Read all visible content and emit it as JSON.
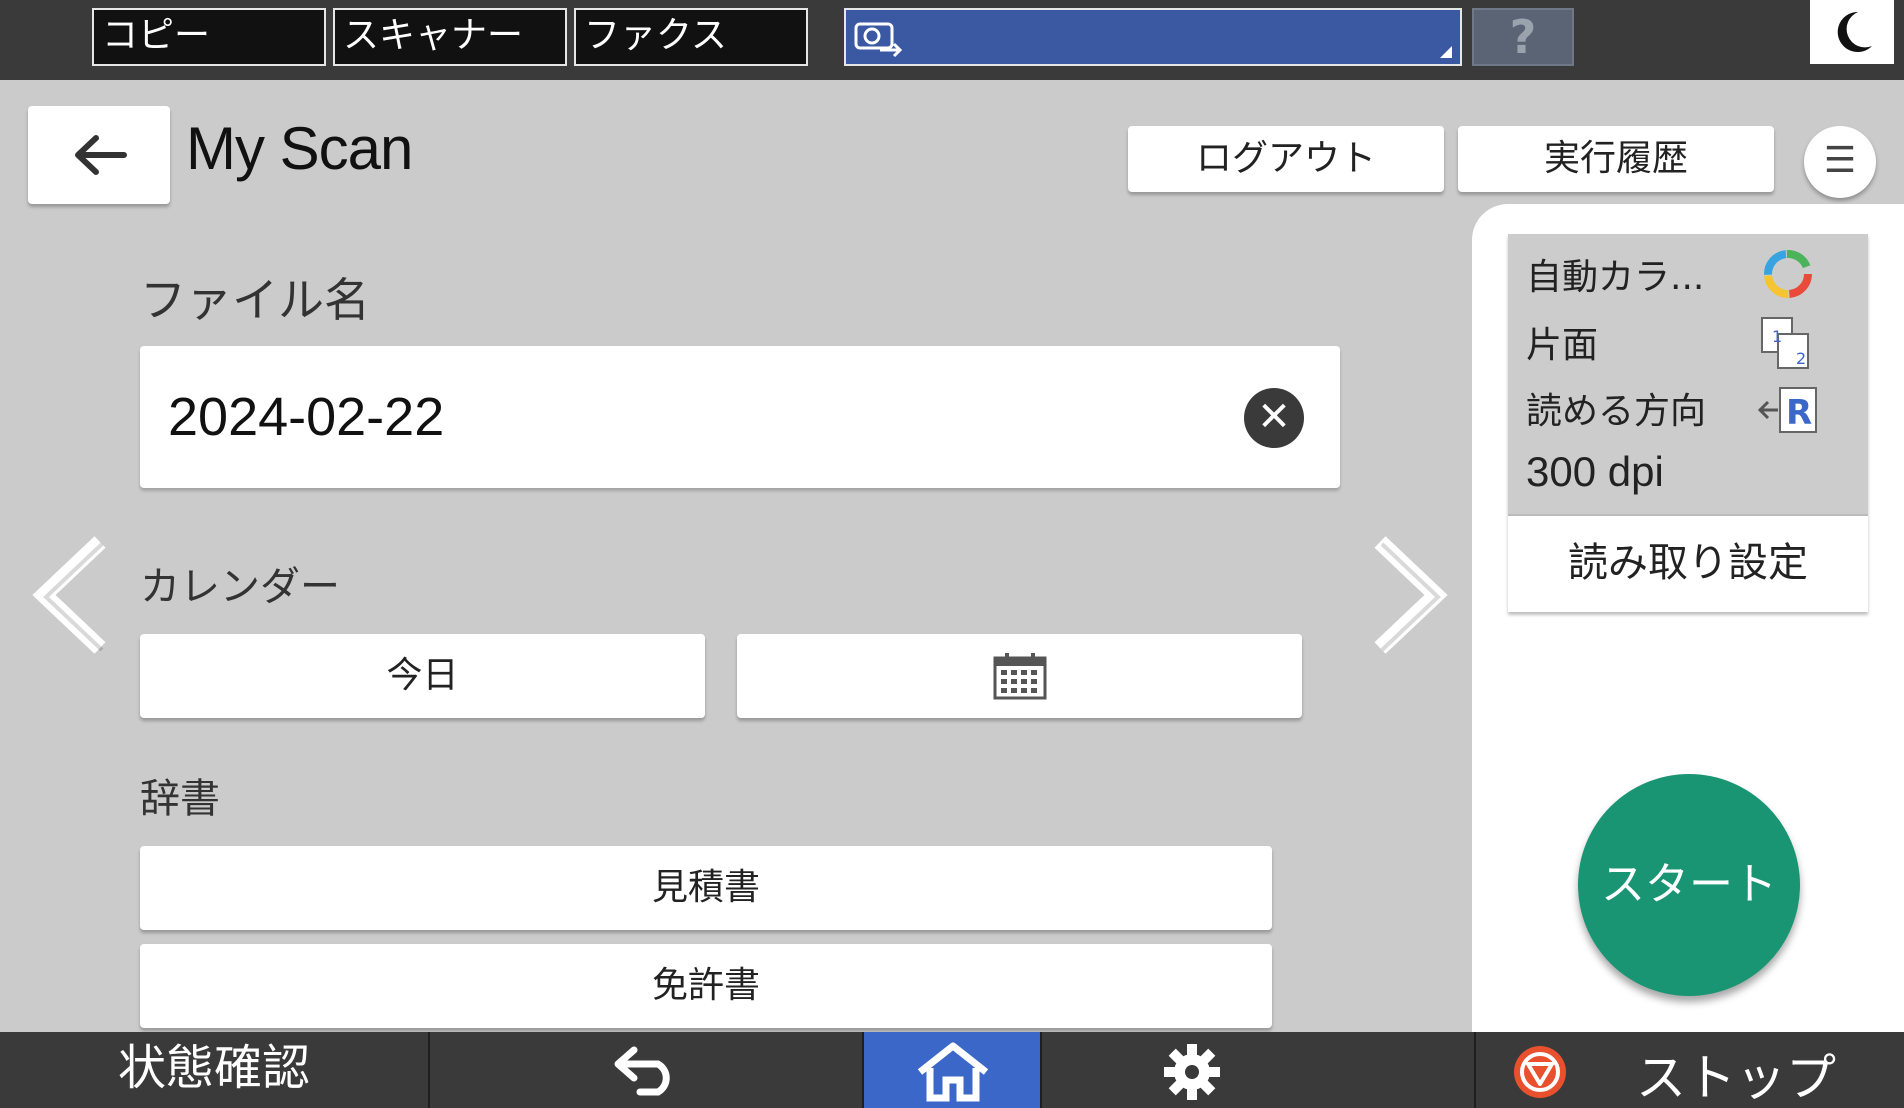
{
  "topbar": {
    "tabs": [
      {
        "label": "コピー"
      },
      {
        "label": "スキャナー"
      },
      {
        "label": "ファクス"
      }
    ],
    "help_label": "?"
  },
  "header": {
    "title": "My Scan",
    "logout_label": "ログアウト",
    "history_label": "実行履歴",
    "menu_label": "☰"
  },
  "form": {
    "filename_label": "ファイル名",
    "filename_value": "2024-02-22",
    "clear_label": "✕",
    "calendar_label": "カレンダー",
    "today_label": "今日",
    "dictionary_label": "辞書",
    "dictionary_items": [
      {
        "label": "見積書"
      },
      {
        "label": "免許書"
      }
    ]
  },
  "settings": {
    "color": "自動カラ...",
    "sides": "片面",
    "orientation": "読める方向",
    "resolution": "300 dpi",
    "read_settings_label": "読み取り設定"
  },
  "start_label": "スタート",
  "bottombar": {
    "status_label": "状態確認",
    "stop_label": "ストップ"
  },
  "colors": {
    "start": "#1a9574",
    "home_active": "#3b68c8",
    "appbar": "#3b58a3"
  }
}
